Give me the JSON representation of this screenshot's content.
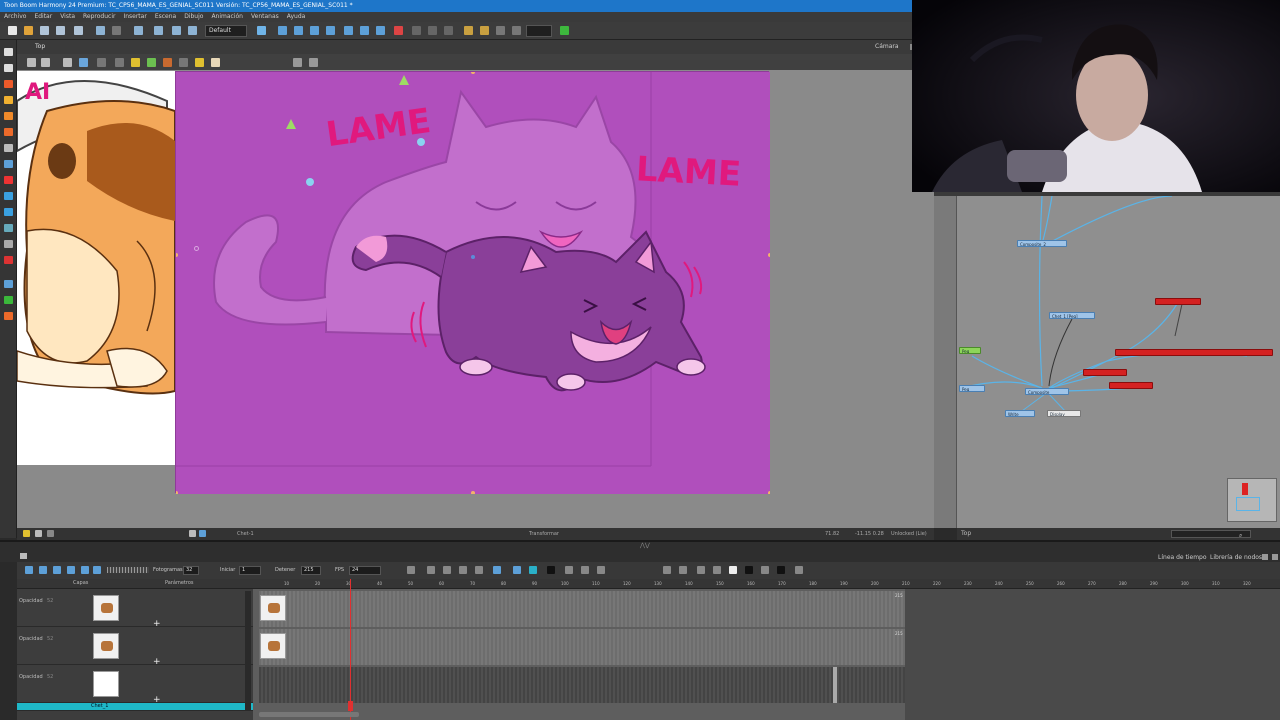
{
  "app": {
    "title": "Toon Boom Harmony 24 Premium: TC_CP56_MAMA_ES_GENIAL_SC011 Versión: TC_CP56_MAMA_ES_GENIAL_SC011 *"
  },
  "menu": {
    "items": [
      "Archivo",
      "Editar",
      "Vista",
      "Reproducir",
      "Insertar",
      "Escena",
      "Dibujo",
      "Animación",
      "Ventanas",
      "Ayuda"
    ]
  },
  "toolbar": {
    "workspace_select": "Default"
  },
  "camera_view": {
    "tab_label": "Top",
    "camera_label": "Cámara",
    "status_left": "Chet-1",
    "status_center": "Transformar",
    "status_right": "Unlocked (Lie)",
    "status_coords": "-11.15 0.28",
    "status_zoom": "71.82"
  },
  "artwork": {
    "lame_1": "LAME",
    "lame_2": "LAME"
  },
  "node_view": {
    "status_label": "Top",
    "nodes": {
      "composite_top": "Composite_2",
      "chet_peg": "Chet_1 [Peg]",
      "green_node": "Peg",
      "left_peg": "Peg",
      "composite_bottom": "Composite",
      "write_node": "Write",
      "display_node": "Display"
    }
  },
  "timeline": {
    "tabs": [
      "Línea de tiempo",
      "Librería de nodos"
    ],
    "fotogramas_label": "Fotogramas",
    "fotogramas_value": "32",
    "iniciar_label": "Iniciar",
    "iniciar_value": "1",
    "detener_label": "Detener",
    "detener_value": "215",
    "fps_label": "FPS",
    "fps_value": "24",
    "layers_header": "Capas",
    "params_header": "Parámetros",
    "layers": [
      {
        "param_label": "Opacidad",
        "param_value": "52"
      },
      {
        "param_label": "Opacidad",
        "param_value": "52"
      },
      {
        "param_label": "Opacidad",
        "param_value": "52"
      },
      {
        "name": "Chet_1"
      }
    ],
    "ruler_ticks": [
      "10",
      "20",
      "30",
      "40",
      "50",
      "60",
      "70",
      "80",
      "90",
      "100",
      "110",
      "120",
      "130",
      "140",
      "150",
      "160",
      "170",
      "180",
      "190",
      "200",
      "210",
      "220",
      "230",
      "240",
      "250",
      "260",
      "270",
      "280",
      "290",
      "300",
      "310",
      "320",
      "330",
      "340"
    ],
    "scene_end_label": "215"
  },
  "colors": {
    "titlebar": "#1e76c9",
    "stage_bg": "#b04fbc",
    "lame_text": "#e0197e",
    "playhead": "#e03030",
    "node_blue": "#9fc4e8",
    "node_red": "#d42121"
  }
}
